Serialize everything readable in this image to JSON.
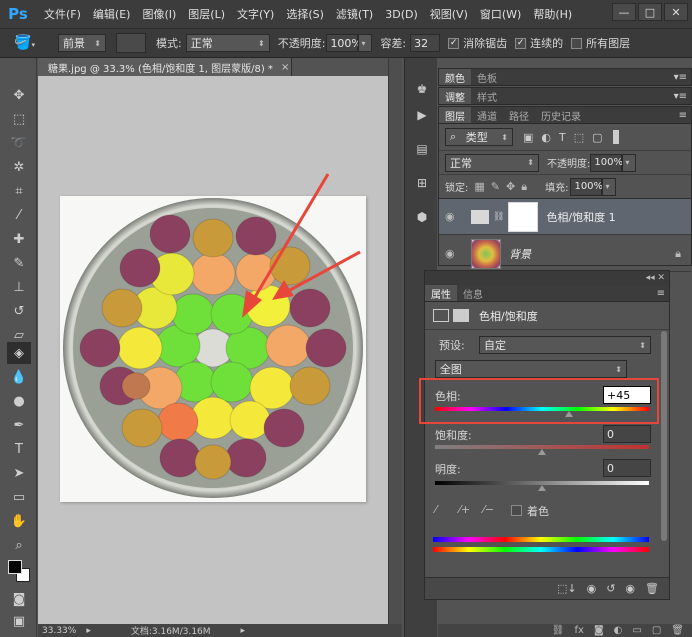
{
  "app": {
    "logo": "Ps"
  },
  "menu": [
    "文件(F)",
    "编辑(E)",
    "图像(I)",
    "图层(L)",
    "文字(Y)",
    "选择(S)",
    "滤镜(T)",
    "3D(D)",
    "视图(V)",
    "窗口(W)",
    "帮助(H)"
  ],
  "window": {
    "minimize": "—",
    "restore": "□",
    "close": "✕"
  },
  "options": {
    "fill_source": "前景",
    "mode_label": "模式:",
    "mode_value": "正常",
    "opacity_label": "不透明度:",
    "opacity_value": "100%",
    "tolerance_label": "容差:",
    "tolerance_value": "32",
    "antialias_label": "消除锯齿",
    "contiguous_label": "连续的",
    "all_layers_label": "所有图层"
  },
  "document": {
    "tab_title": "糖果.jpg @ 33.3% (色相/饱和度 1, 图层蒙版/8) *",
    "close": "×",
    "zoom": "33.33%",
    "doc_size": "文档:3.16M/3.16M"
  },
  "panels": {
    "color_tabs": [
      "颜色",
      "色板"
    ],
    "adjust_tabs": [
      "调整",
      "样式"
    ],
    "layers_tabs": [
      "图层",
      "通道",
      "路径",
      "历史记录"
    ],
    "filter_kind": "类型",
    "blend_mode": "正常",
    "opacity_label": "不透明度:",
    "opacity_value": "100%",
    "lock_label": "锁定:",
    "fill_label": "填充:",
    "fill_value": "100%",
    "layers": [
      {
        "name": "色相/饱和度 1",
        "selected": true
      },
      {
        "name": "背景",
        "selected": false
      }
    ]
  },
  "properties": {
    "tabs": [
      "属性",
      "信息"
    ],
    "title": "色相/饱和度",
    "preset_label": "预设:",
    "preset_value": "自定",
    "channel_value": "全图",
    "hue_label": "色相:",
    "hue_value": "+45",
    "hue_fraction": 0.625,
    "saturation_label": "饱和度:",
    "saturation_value": "0",
    "saturation_fraction": 0.5,
    "lightness_label": "明度:",
    "lightness_value": "0",
    "lightness_fraction": 0.5,
    "colorize_label": "着色"
  },
  "colors": {
    "highlight": "#e8463b",
    "accent": "#31a8ff"
  }
}
